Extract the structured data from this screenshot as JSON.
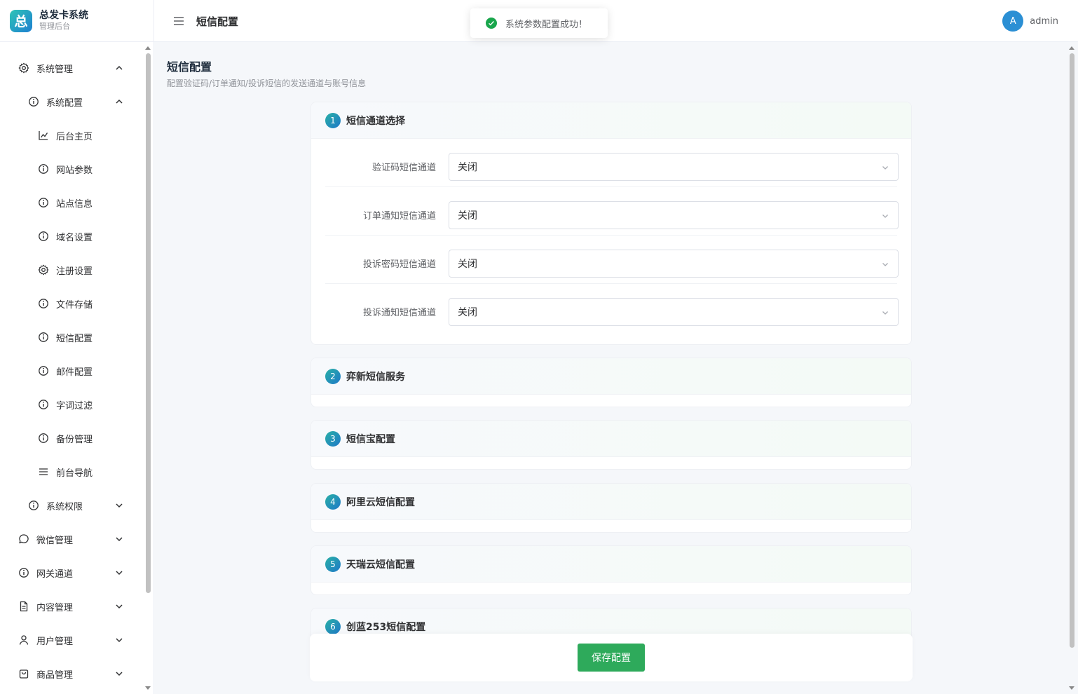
{
  "brand": {
    "logo_char": "总",
    "title": "总发卡系统",
    "subtitle": "管理后台"
  },
  "header": {
    "title": "短信配置",
    "user_initial": "A",
    "username": "admin"
  },
  "toast": {
    "message": "系统参数配置成功！"
  },
  "sidebar": {
    "items": [
      {
        "label": "系统管理",
        "icon": "gear-icon",
        "level": 1,
        "chevron": "up"
      },
      {
        "label": "系统配置",
        "icon": "info-icon",
        "level": 2,
        "chevron": "up"
      },
      {
        "label": "后台主页",
        "icon": "chart-icon",
        "level": 3
      },
      {
        "label": "网站参数",
        "icon": "info-icon",
        "level": 3
      },
      {
        "label": "站点信息",
        "icon": "info-icon",
        "level": 3
      },
      {
        "label": "域名设置",
        "icon": "info-icon",
        "level": 3
      },
      {
        "label": "注册设置",
        "icon": "gear-icon",
        "level": 3
      },
      {
        "label": "文件存储",
        "icon": "info-icon",
        "level": 3
      },
      {
        "label": "短信配置",
        "icon": "info-icon",
        "level": 3
      },
      {
        "label": "邮件配置",
        "icon": "info-icon",
        "level": 3
      },
      {
        "label": "字词过滤",
        "icon": "info-icon",
        "level": 3
      },
      {
        "label": "备份管理",
        "icon": "info-icon",
        "level": 3
      },
      {
        "label": "前台导航",
        "icon": "menu-icon",
        "level": 3
      },
      {
        "label": "系统权限",
        "icon": "info-icon",
        "level": 2,
        "chevron": "down"
      },
      {
        "label": "微信管理",
        "icon": "chat-icon",
        "level": 1,
        "chevron": "down"
      },
      {
        "label": "网关通道",
        "icon": "info-icon",
        "level": 1,
        "chevron": "down"
      },
      {
        "label": "内容管理",
        "icon": "document-icon",
        "level": 1,
        "chevron": "down"
      },
      {
        "label": "用户管理",
        "icon": "user-icon",
        "level": 1,
        "chevron": "down"
      },
      {
        "label": "商品管理",
        "icon": "bag-icon",
        "level": 1,
        "chevron": "down"
      }
    ]
  },
  "main": {
    "title": "短信配置",
    "description": "配置验证码/订单通知/投诉短信的发送通道与账号信息",
    "sections": [
      {
        "num": "1",
        "title": "短信通道选择",
        "fields": [
          {
            "label": "验证码短信通道",
            "value": "关闭"
          },
          {
            "label": "订单通知短信通道",
            "value": "关闭"
          },
          {
            "label": "投诉密码短信通道",
            "value": "关闭"
          },
          {
            "label": "投诉通知短信通道",
            "value": "关闭"
          }
        ]
      },
      {
        "num": "2",
        "title": "弈新短信服务"
      },
      {
        "num": "3",
        "title": "短信宝配置"
      },
      {
        "num": "4",
        "title": "阿里云短信配置"
      },
      {
        "num": "5",
        "title": "天瑞云短信配置"
      },
      {
        "num": "6",
        "title": "创蓝253短信配置"
      }
    ],
    "save_label": "保存配置"
  },
  "colors": {
    "accent_green": "#2eaa5b",
    "badge_blue": "#1e78c8",
    "success": "#19a64c"
  }
}
